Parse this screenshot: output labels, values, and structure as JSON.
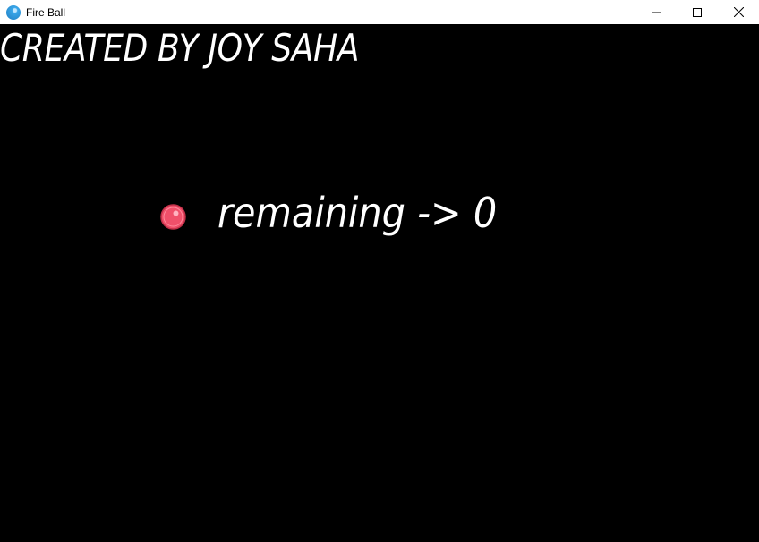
{
  "window": {
    "title": "Fire Ball",
    "icon": "fireball-app-icon"
  },
  "window_controls": {
    "minimize_icon": "minimize-icon",
    "maximize_icon": "maximize-icon",
    "close_icon": "close-icon"
  },
  "game": {
    "credit": "CREATED BY JOY SAHA",
    "remaining_text": "remaining -> 0",
    "ball_icon": "red-ball-icon",
    "colors": {
      "background": "#000000",
      "text": "#ffffff",
      "ball": "#f0506a",
      "ball_outline": "#c03048"
    }
  }
}
